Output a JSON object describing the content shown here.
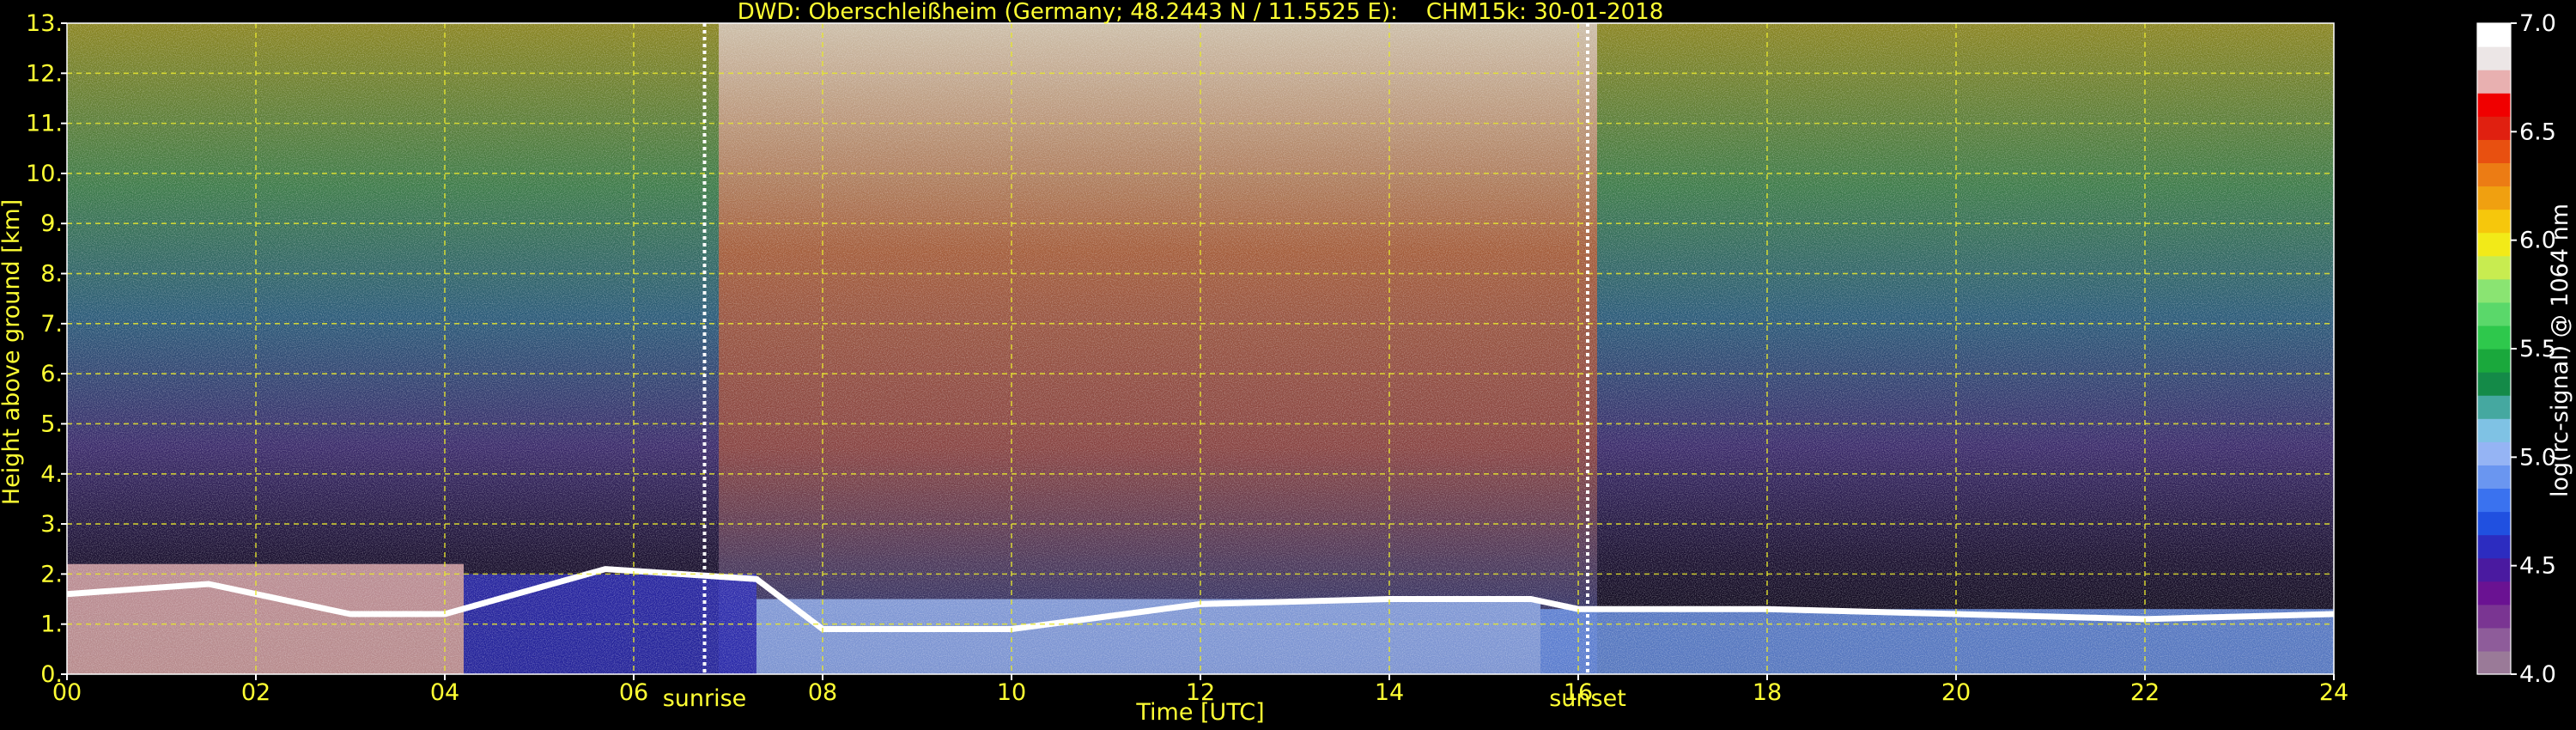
{
  "chart_data": {
    "type": "heatmap",
    "title": "DWD: Oberschleißheim (Germany; 48.2443 N / 11.5525 E):    CHM15k: 30-01-2018",
    "xlabel": "Time [UTC]",
    "ylabel": "Height above ground [km]",
    "xlim": [
      0,
      24
    ],
    "ylim": [
      0,
      13
    ],
    "x_ticks": [
      "00",
      "02",
      "04",
      "06",
      "08",
      "10",
      "12",
      "14",
      "16",
      "18",
      "20",
      "22",
      "24"
    ],
    "y_ticks": [
      "0.",
      "1.",
      "2.",
      "3.",
      "4.",
      "5.",
      "6.",
      "7.",
      "8.",
      "9.",
      "10.",
      "11.",
      "12.",
      "13."
    ],
    "grid": true,
    "annotations": [
      {
        "label": "sunrise",
        "x": 6.75
      },
      {
        "label": "sunset",
        "x": 16.1
      }
    ],
    "colorbar": {
      "label": "log(rc-signal) @ 1064 nm",
      "range": [
        4.0,
        7.0
      ],
      "ticks": [
        "4.0",
        "4.5",
        "5.0",
        "5.5",
        "6.0",
        "6.5",
        "7.0"
      ],
      "colors": [
        "#9a7a98",
        "#8e5c9a",
        "#7a3592",
        "#6a1292",
        "#4a1aa0",
        "#2c2cc0",
        "#2050e0",
        "#3a72ef",
        "#6a96f0",
        "#95b4f4",
        "#7fc2e4",
        "#45a8a0",
        "#148a48",
        "#1aa83c",
        "#2ec84c",
        "#5ad86a",
        "#8ae472",
        "#c8ec50",
        "#f2ea18",
        "#f6c70c",
        "#f0a010",
        "#ec7c14",
        "#e85010",
        "#e02010",
        "#f00000",
        "#e8b0b0",
        "#ece6e6",
        "#ffffff"
      ]
    },
    "profile_layers": [
      {
        "x_start": 0.0,
        "x_end": 4.2,
        "bottom": 0.0,
        "top": 2.2,
        "value": 6.8
      },
      {
        "x_start": 4.2,
        "x_end": 7.3,
        "bottom": 0.0,
        "top": 2.0,
        "value": 4.5
      },
      {
        "x_start": 7.3,
        "x_end": 15.6,
        "bottom": 0.0,
        "top": 1.5,
        "value": 5.0
      },
      {
        "x_start": 15.6,
        "x_end": 24.0,
        "bottom": 0.0,
        "top": 1.3,
        "value": 4.9
      }
    ],
    "cloud_top_height": [
      {
        "x": 0.0,
        "y": 1.6
      },
      {
        "x": 1.5,
        "y": 1.8
      },
      {
        "x": 3.0,
        "y": 1.2
      },
      {
        "x": 4.0,
        "y": 1.2
      },
      {
        "x": 5.7,
        "y": 2.1
      },
      {
        "x": 7.3,
        "y": 1.9
      },
      {
        "x": 8.0,
        "y": 0.9
      },
      {
        "x": 10.0,
        "y": 0.9
      },
      {
        "x": 12.0,
        "y": 1.4
      },
      {
        "x": 14.0,
        "y": 1.5
      },
      {
        "x": 15.5,
        "y": 1.5
      },
      {
        "x": 16.0,
        "y": 1.3
      },
      {
        "x": 18.0,
        "y": 1.3
      },
      {
        "x": 20.0,
        "y": 1.2
      },
      {
        "x": 22.0,
        "y": 1.1
      },
      {
        "x": 24.0,
        "y": 1.2
      }
    ]
  }
}
